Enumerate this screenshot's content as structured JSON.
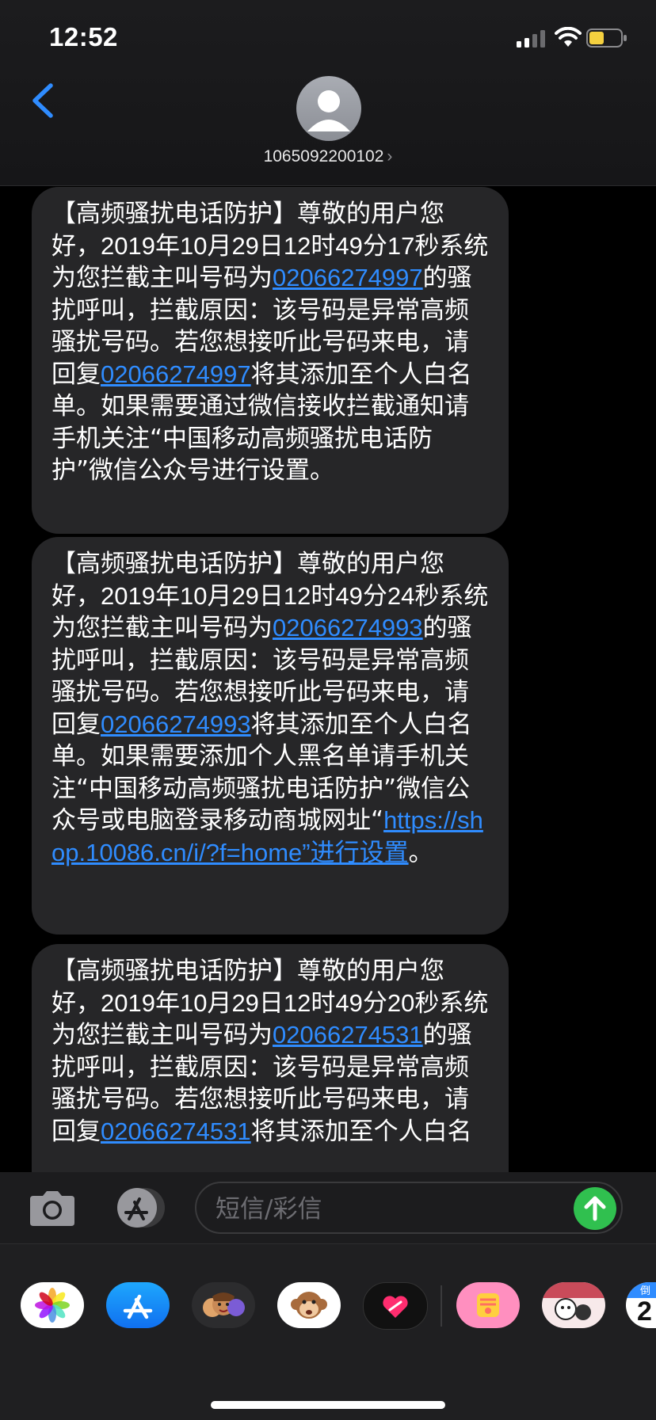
{
  "status_bar": {
    "time": "12:52",
    "signal_icon": "signal-bars-icon",
    "wifi_icon": "wifi-icon",
    "battery_icon": "battery-icon",
    "battery_color": "#f4d03f"
  },
  "header": {
    "back_icon": "chevron-left-icon",
    "avatar_icon": "person-icon",
    "contact": "1065092200102",
    "contact_chevron": "›"
  },
  "messages": [
    {
      "intro": "【高频骚扰电话防护】尊敬的用户您好，",
      "datetime": "2019年10月29日12时49分17秒",
      "mid1": "系统为您拦截主叫号码为",
      "number": "02066274997",
      "mid2": "的骚扰呼叫，拦截原因：该号码是异常高频骚扰号码。若您想接听此号码来电，请回复",
      "number2": "02066274997",
      "tail": "将其添加至个人白名单。如果需要通过微信接收拦截通知请手机关注“中国移动高频骚扰电话防护”微信公众号进行设置。"
    },
    {
      "intro": "【高频骚扰电话防护】尊敬的用户您好，",
      "datetime": "2019年10月29日12时49分24秒",
      "mid1": "系统为您拦截主叫号码为",
      "number": "02066274993",
      "mid2": "的骚扰呼叫，拦截原因：该号码是异常高频骚扰号码。若您想接听此号码来电，请回复",
      "number2": "02066274993",
      "tail": "将其添加至个人白名单。如果需要添加个人黑名单请手机关注“中国移动高频骚扰电话防护”微信公众号或电脑登录移动商城网址“",
      "url": "https://shop.10086.cn/i/?f=home”进行设置",
      "end": "。"
    },
    {
      "intro": "【高频骚扰电话防护】尊敬的用户您好，",
      "datetime": "2019年10月29日12时49分20秒",
      "mid1": "系统为您拦截主叫号码为",
      "number": "02066274531",
      "mid2": "的骚扰呼叫，拦截原因：该号码是异常高频骚扰号码。若您想接听此号码来电，请回复",
      "number2": "02066274531",
      "tail": "将其添加至个人白名"
    }
  ],
  "input_bar": {
    "camera_icon": "camera-icon",
    "apps_icon": "app-store-icon",
    "placeholder": "短信/彩信",
    "send_icon": "arrow-up-icon",
    "send_color": "#30c04f"
  },
  "app_drawer": {
    "apps": [
      "photos-icon",
      "app-store-icon",
      "memoji-icon",
      "animoji-monkey-icon",
      "digital-touch-heart-icon",
      "sticker-app-icon",
      "cartoon-sticker-icon",
      "calendar-countdown-icon"
    ],
    "calendar_badge_top": "倒",
    "calendar_badge_num": "2"
  }
}
